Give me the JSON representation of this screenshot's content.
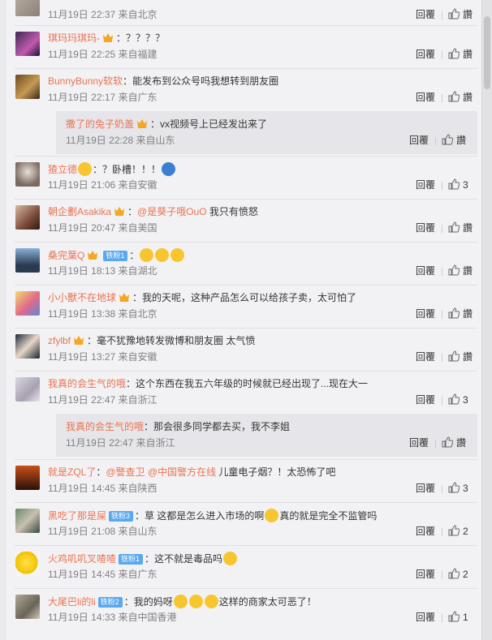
{
  "actions": {
    "reply_label": "回覆",
    "like_label": "讚"
  },
  "colors": {
    "username": "#eb7350",
    "badge": "#5aa8ee",
    "background": "#f2f2f5"
  },
  "comments": [
    {
      "username": "",
      "text": "",
      "time": "11月19日 22:37 来自北京",
      "likes": "讚"
    },
    {
      "username": "琪玛玛琪玛-",
      "text": "：？？？？",
      "time": "11月19日 22:25 来自福建",
      "likes": "讚"
    },
    {
      "username": "BunnyBunny软软",
      "text": "：能发布到公众号吗我想转到朋友圈",
      "time": "11月19日 22:17 来自广东",
      "likes": "讚",
      "reply": {
        "username": "撒了的兔子奶盖",
        "text": "：vx视频号上已经发出来了",
        "time": "11月19日 22:28 来自山东",
        "likes": "讚"
      }
    },
    {
      "username": "猹立德",
      "text": "：？卧槽！！！",
      "time": "11月19日 21:06 来自安徽",
      "likes": "3"
    },
    {
      "username": "朝企劃Asakika",
      "mention": "@是葵子哦OuO",
      "text": " 我只有愤怒",
      "time": "11月19日 20:47 来自美国",
      "likes": "讚"
    },
    {
      "username": "桑完葉Q",
      "badge": "铁粉1",
      "text": "：",
      "time": "11月19日 18:13 来自湖北",
      "likes": "讚"
    },
    {
      "username": "小小獸不在地球",
      "text": "：我的天呢，这种产品怎么可以给孩子卖，太可怕了",
      "time": "11月19日 13:38 来自北京",
      "likes": "讚"
    },
    {
      "username": "zfylbf",
      "text": "：毫不犹豫地转发微博和朋友圈 太气愤",
      "time": "11月19日 13:27 来自安徽",
      "likes": "讚"
    },
    {
      "username": "我真的会生气的哦",
      "text": "：这个东西在我五六年级的时候就已经出现了...现在大一",
      "time": "11月19日 22:47 来自浙江",
      "likes": "3",
      "reply": {
        "username": "我真的会生气的哦",
        "text": "：那会很多同学都去买，我不李姐",
        "time": "11月19日 22:47 来自浙江",
        "likes": "讚"
      }
    },
    {
      "username": "就是ZQL了",
      "text": "：",
      "mention": "@警查卫",
      "mention2": "@中国警方在线",
      "text2": " 儿童电子烟？！太恐怖了吧",
      "time": "11月19日 14:45 来自陕西",
      "likes": "3"
    },
    {
      "username": "黑吃了那是屎",
      "badge": "铁粉3",
      "text": "：草 这都是怎么进入市场的啊",
      "text2": "真的就是完全不监管吗",
      "time": "11月19日 21:08 来自山东",
      "likes": "2"
    },
    {
      "username": "火鸡叽叽叉喳喳",
      "badge": "铁粉1",
      "text": "：这不就是毒品吗",
      "time": "11月19日 14:45 来自广东",
      "likes": "2"
    },
    {
      "username": "大尾巴li的li",
      "badge": "铁粉2",
      "text": "：我的妈呀",
      "text2": "这样的商家太可恶了！",
      "time": "11月19日 14:33 来自中国香港",
      "likes": "1"
    }
  ]
}
